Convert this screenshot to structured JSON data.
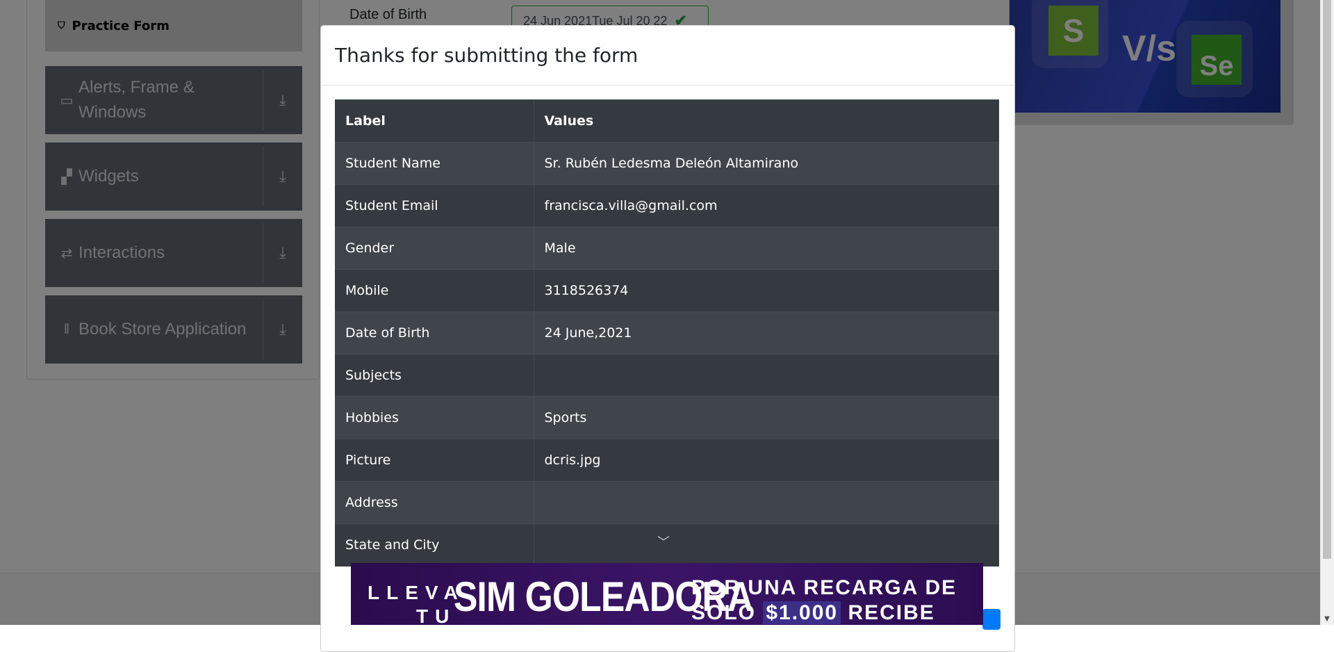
{
  "sidebar": {
    "practice_form": "Practice Form",
    "groups": [
      {
        "label_line1": "Alerts, Frame &",
        "label_line2": "Windows",
        "icon": "window-icon"
      },
      {
        "label_line1": "Widgets",
        "label_line2": "",
        "icon": "widgets-icon"
      },
      {
        "label_line1": "Interactions",
        "label_line2": "",
        "icon": "interactions-icon"
      },
      {
        "label_line1": "Book Store Application",
        "label_line2": "",
        "icon": "books-icon"
      }
    ]
  },
  "form": {
    "dob_label": "Date of Birth",
    "dob_value": "24 Jun 2021Tue Jul 20 22"
  },
  "banner": {
    "logo_left": "S",
    "vs_text": "V/s",
    "logo_right": "Se"
  },
  "modal": {
    "title": "Thanks for submitting the form",
    "columns": [
      "Label",
      "Values"
    ],
    "rows": [
      {
        "label": "Student Name",
        "value": "Sr. Rubén Ledesma Deleón Altamirano"
      },
      {
        "label": "Student Email",
        "value": "francisca.villa@gmail.com"
      },
      {
        "label": "Gender",
        "value": "Male"
      },
      {
        "label": "Mobile",
        "value": "3118526374"
      },
      {
        "label": "Date of Birth",
        "value": "24 June,2021"
      },
      {
        "label": "Subjects",
        "value": ""
      },
      {
        "label": "Hobbies",
        "value": "Sports"
      },
      {
        "label": "Picture",
        "value": "dcris.jpg"
      },
      {
        "label": "Address",
        "value": ""
      },
      {
        "label": "State and City",
        "value": ""
      }
    ]
  },
  "ad": {
    "line_small_1": "LLEVA",
    "line_small_2": "TU",
    "big_text": "SIM GOLEADORA",
    "right_line1": "POR UNA RECARGA DE",
    "right_line2_pre": "SOLO ",
    "right_line2_hl": "$1.000",
    "right_line2_post": " RECIBE"
  },
  "colors": {
    "modal_table_dark": "#343a40",
    "modal_table_stripe": "#3f454b",
    "sidebar_group": "#636a75",
    "success_border": "#28a745",
    "primary_button": "#007bff",
    "ad_background": "#2a0c4e"
  }
}
